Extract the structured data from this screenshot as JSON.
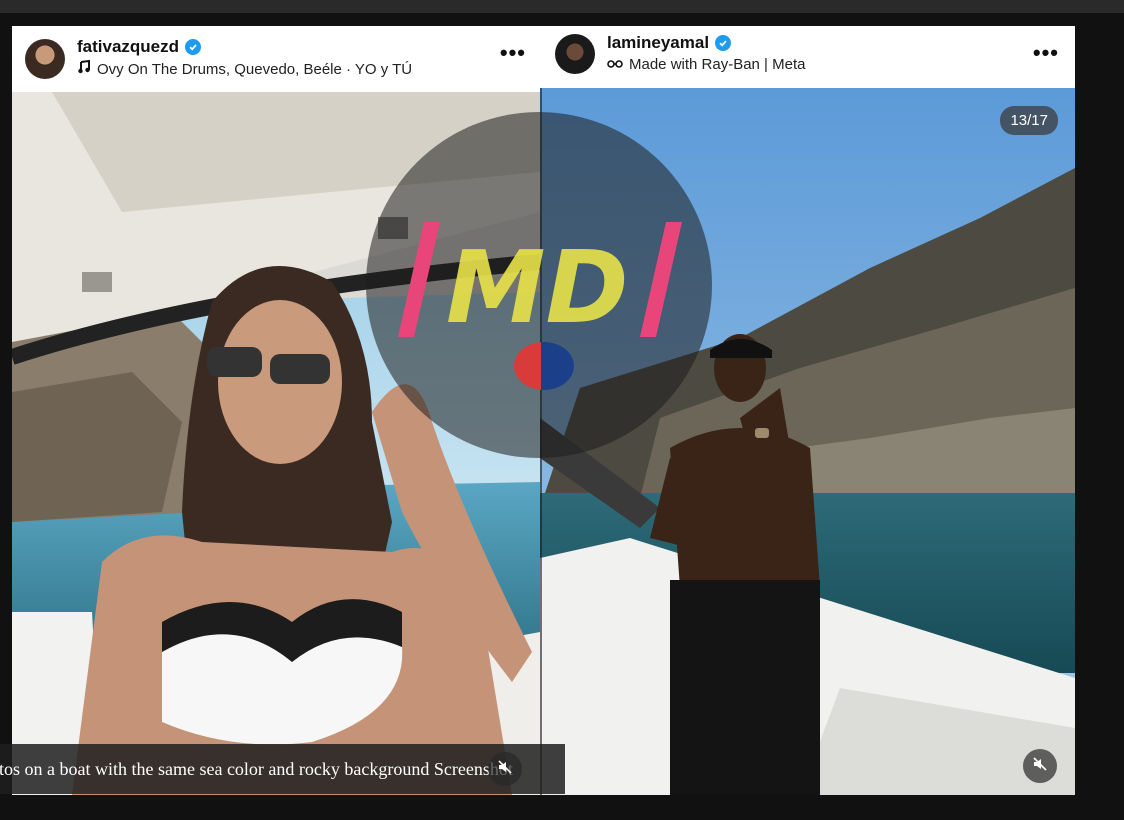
{
  "posts": [
    {
      "username": "fativazquezd",
      "audio": "Ovy On The Drums, Quevedo, Beéle · YO y TÚ",
      "more_label": "•••"
    },
    {
      "username": "lamineyamal",
      "audio": "Made with Ray-Ban | Meta",
      "more_label": "•••",
      "counter": "13/17"
    }
  ],
  "watermark": {
    "text": "MD"
  },
  "caption": "otos on a boat with the same sea color and rocky background Screenshot",
  "colors": {
    "verified": "#1d9bf0",
    "watermark_pink": "#e8457a",
    "watermark_yellow": "#e8e34a"
  }
}
